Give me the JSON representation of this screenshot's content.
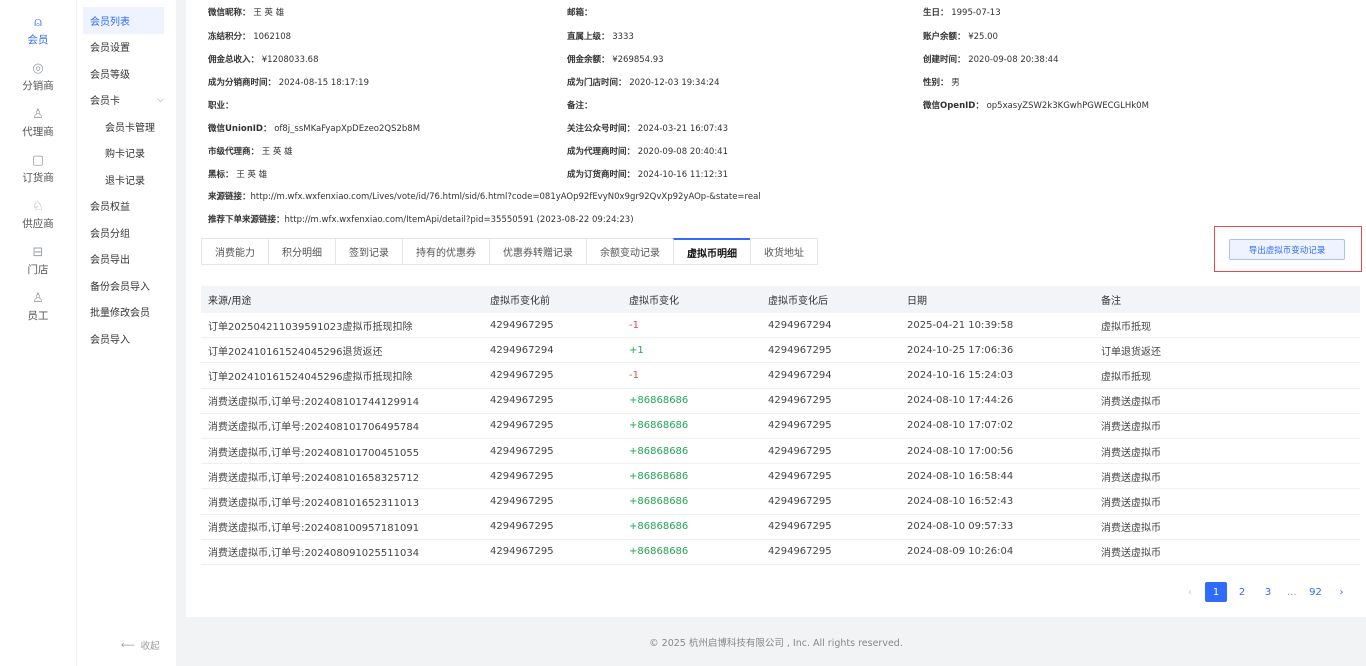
{
  "rail": [
    {
      "label": "会员",
      "icon": "user-icon",
      "glyph": "⍝",
      "active": true
    },
    {
      "label": "分销商",
      "icon": "distributor-icon",
      "glyph": "◎",
      "active": false
    },
    {
      "label": "代理商",
      "icon": "agent-icon",
      "glyph": "♙",
      "active": false
    },
    {
      "label": "订货商",
      "icon": "order-icon",
      "glyph": "▢",
      "active": false
    },
    {
      "label": "供应商",
      "icon": "supplier-icon",
      "glyph": "♘",
      "active": false
    },
    {
      "label": "门店",
      "icon": "store-icon",
      "glyph": "⊟",
      "active": false
    },
    {
      "label": "员工",
      "icon": "staff-icon",
      "glyph": "♙",
      "active": false
    }
  ],
  "submenu": {
    "items": [
      "会员列表",
      "会员设置",
      "会员等级",
      "会员卡",
      "会员卡管理",
      "购卡记录",
      "退卡记录",
      "会员权益",
      "会员分组",
      "会员导出",
      "备份会员导入",
      "批量修改会员",
      "会员导入"
    ],
    "collapse_label": "收起",
    "collapse_glyph": "⟵"
  },
  "info": {
    "nickname_label": "微信昵称：",
    "nickname": "王 英 雄",
    "email_label": "邮箱：",
    "email": "",
    "birthday_label": "生日：",
    "birthday": "1995-07-13",
    "frozen_label": "冻结积分：",
    "frozen": "1062108",
    "superior_label": "直属上级：",
    "superior": "3333",
    "balance_label": "账户余额：",
    "balance": "¥25.00",
    "commission_total_label": "佣金总收入：",
    "commission_total": "¥1208033.68",
    "commission_balance_label": "佣金余额：",
    "commission_balance": "¥269854.93",
    "created_label": "创建时间：",
    "created": "2020-09-08 20:38:44",
    "distributor_time_label": "成为分销商时间：",
    "distributor_time": "2024-08-15 18:17:19",
    "store_time_label": "成为门店时间：",
    "store_time": "2020-12-03 19:34:24",
    "gender_label": "性别：",
    "gender": "男",
    "job_label": "职业：",
    "job": "",
    "remark_label": "备注：",
    "remark": "",
    "openid_label": "微信OpenID：",
    "openid": "op5xasyZSW2k3KGwhPGWECGLHk0M",
    "unionid_label": "微信UnionID：",
    "unionid": "of8j_ssMKaFyapXpDEzeo2QS2b8M",
    "follow_label": "关注公众号时间：",
    "follow": "2024-03-21 16:07:43",
    "city_agent_label": "市级代理商：",
    "city_agent": "王 英 雄",
    "agent_time_label": "成为代理商时间：",
    "agent_time": "2020-09-08 20:40:41",
    "tag_label": "黑标：",
    "tag": "王 英 雄",
    "orderer_time_label": "成为订货商时间：",
    "orderer_time": "2024-10-16 11:12:31",
    "source_label": "来源链接：",
    "source": "http://m.wfx.wxfenxiao.com/Lives/vote/id/76.html/sid/6.html?code=081yAOp92fEvyN0x9gr92QvXp92yAOp-&state=real",
    "recommend_label": "推荐下单来源链接：",
    "recommend": "http://m.wfx.wxfenxiao.com/ItemApi/detail?pid=35550591 (2023-08-22 09:24:23)"
  },
  "tabs": [
    "消费能力",
    "积分明细",
    "签到记录",
    "持有的优惠券",
    "优惠券转赠记录",
    "余额变动记录",
    "虚拟币明细",
    "收货地址"
  ],
  "active_tab": 6,
  "export_label": "导出虚拟币变动记录",
  "table": {
    "headers": [
      "来源/用途",
      "虚拟币变化前",
      "虚拟币变化",
      "虚拟币变化后",
      "日期",
      "备注"
    ],
    "rows": [
      [
        "订单202504211039591023虚拟币抵现扣除",
        "4294967295",
        "-1",
        "4294967294",
        "2025-04-21 10:39:58",
        "虚拟币抵现"
      ],
      [
        "订单2024101615240452​96退货返还",
        "4294967294",
        "+1",
        "4294967295",
        "2024-10-25 17:06:36",
        "订单退货返还"
      ],
      [
        "订单202410161524045296虚拟币抵现扣除",
        "4294967295",
        "-1",
        "4294967294",
        "2024-10-16 15:24:03",
        "虚拟币抵现"
      ],
      [
        "消费送虚拟币,订单号:202408101744129914",
        "4294967295",
        "+86868686",
        "4294967295",
        "2024-08-10 17:44:26",
        "消费送虚拟币"
      ],
      [
        "消费送虚拟币,订单号:202408101706495784",
        "4294967295",
        "+86868686",
        "4294967295",
        "2024-08-10 17:07:02",
        "消费送虚拟币"
      ],
      [
        "消费送虚拟币,订单号:202408101700451055",
        "4294967295",
        "+86868686",
        "4294967295",
        "2024-08-10 17:00:56",
        "消费送虚拟币"
      ],
      [
        "消费送虚拟币,订单号:202408101658325712",
        "4294967295",
        "+86868686",
        "4294967295",
        "2024-08-10 16:58:44",
        "消费送虚拟币"
      ],
      [
        "消费送虚拟币,订单号:202408101652311013",
        "4294967295",
        "+86868686",
        "4294967295",
        "2024-08-10 16:52:43",
        "消费送虚拟币"
      ],
      [
        "消费送虚拟币,订单号:202408100957181091",
        "4294967295",
        "+86868686",
        "4294967295",
        "2024-08-10 09:57:33",
        "消费送虚拟币"
      ],
      [
        "消费送虚拟币,订单号:202408091025511034",
        "4294967295",
        "+86868686",
        "4294967295",
        "2024-08-09 10:26:04",
        "消费送虚拟币"
      ]
    ]
  },
  "pagination": {
    "prev": "‹",
    "pages": [
      "1",
      "2",
      "3",
      "...",
      "92"
    ],
    "current": "1",
    "next": "›"
  },
  "footer": "© 2025 杭州启博科技有限公司 , Inc. All rights reserved.",
  "colors": {
    "accent": "#2f6bff",
    "negative": "#e5484d",
    "positive": "#23a455",
    "highlight_box": "#e5484d"
  }
}
